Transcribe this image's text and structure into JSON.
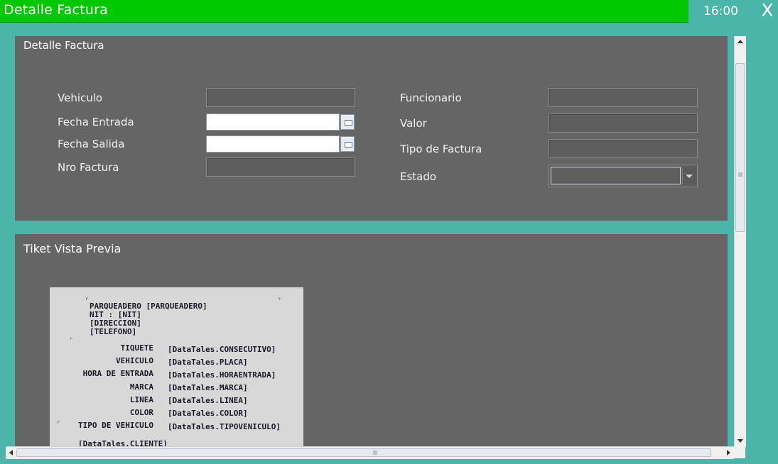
{
  "window": {
    "title": "Detalle Factura",
    "clock": "16:00",
    "close_label": "X",
    "title_bar_color": "#00c800",
    "background_color": "#4bb5ab"
  },
  "detail_panel": {
    "title": "Detalle Factura",
    "left_fields": [
      {
        "label": "Vehiculo",
        "value": ""
      },
      {
        "label": "Fecha Entrada",
        "value": ""
      },
      {
        "label": "Fecha Salida",
        "value": ""
      },
      {
        "label": "Nro Factura",
        "value": ""
      }
    ],
    "right_fields": [
      {
        "label": "Funcionario",
        "value": ""
      },
      {
        "label": "Valor",
        "value": ""
      },
      {
        "label": "Tipo de Factura",
        "value": ""
      },
      {
        "label": "Estado",
        "value": ""
      }
    ]
  },
  "preview_panel": {
    "title": "Tiket Vista Previa",
    "ticket": {
      "header_lines": [
        "PARQUEADERO  [PARQUEADERO]",
        "NIT : [NIT]",
        "[DIRECCION]",
        "[TELEFONO]"
      ],
      "rows": [
        {
          "label": "TIQUETE",
          "value": "[DataTales.CONSECUTIVO]"
        },
        {
          "label": "VEHICULO",
          "value": "[DataTales.PLACA]"
        },
        {
          "label": "HORA DE ENTRADA",
          "value": "[DataTales.HORAENTRADA]"
        },
        {
          "label": "MARCA",
          "value": "[DataTales.MARCA]"
        },
        {
          "label": "LINEA",
          "value": "[DataTales.LINEA]"
        },
        {
          "label": "COLOR",
          "value": "[DataTales.COLOR]"
        },
        {
          "label": "TIPO DE VEHICULO",
          "value": "[DataTales.TIPOVENICULO]"
        }
      ],
      "footer": "[DataTales.CLIENTE]"
    }
  }
}
